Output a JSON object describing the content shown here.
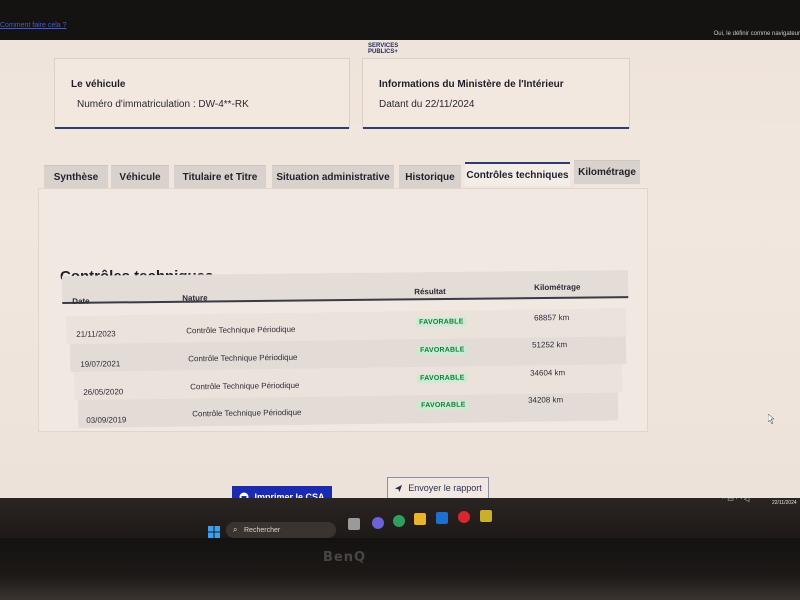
{
  "browser": {
    "top_link": "Comment faire cela ?",
    "top_right_note": "Oui, le définir comme navigateur"
  },
  "header": {
    "logo_line1": "SERVICES",
    "logo_line2": "PUBLICS+"
  },
  "vehicle_card": {
    "title": "Le véhicule",
    "registration": "Numéro d'immatriculation : DW-4**-RK"
  },
  "ministry_card": {
    "title": "Informations du Ministère de l'Intérieur",
    "date": "Datant du 22/11/2024"
  },
  "tabs": [
    {
      "label": "Synthèse"
    },
    {
      "label": "Véhicule"
    },
    {
      "label": "Titulaire et Titre"
    },
    {
      "label": "Situation administrative"
    },
    {
      "label": "Historique"
    },
    {
      "label": "Contrôles techniques"
    },
    {
      "label": "Kilométrage"
    }
  ],
  "active_tab": "Contrôles techniques",
  "section": {
    "title": "Contrôles techniques"
  },
  "table": {
    "headers": {
      "date": "Date",
      "nature": "Nature",
      "result": "Résultat",
      "mileage": "Kilométrage"
    },
    "rows": [
      {
        "date": "21/11/2023",
        "nature": "Contrôle Technique Périodique",
        "result": "FAVORABLE",
        "mileage": "68857 km"
      },
      {
        "date": "19/07/2021",
        "nature": "Contrôle Technique Périodique",
        "result": "FAVORABLE",
        "mileage": "51252 km"
      },
      {
        "date": "26/05/2020",
        "nature": "Contrôle Technique Périodique",
        "result": "FAVORABLE",
        "mileage": "34604 km"
      },
      {
        "date": "03/09/2019",
        "nature": "Contrôle Technique Périodique",
        "result": "FAVORABLE",
        "mileage": "34208 km"
      }
    ]
  },
  "buttons": {
    "print": "Imprimer le CSA",
    "send": "Envoyer le rapport"
  },
  "taskbar": {
    "search_placeholder": "Rechercher",
    "time": "15:57",
    "date": "22/11/2024"
  },
  "monitor": {
    "brand": "BenQ"
  },
  "colors": {
    "primary": "#1a2bb0",
    "accent_bar": "#2d3f6f",
    "badge_bg": "#c9ecd3",
    "badge_text": "#1b7a3a"
  }
}
